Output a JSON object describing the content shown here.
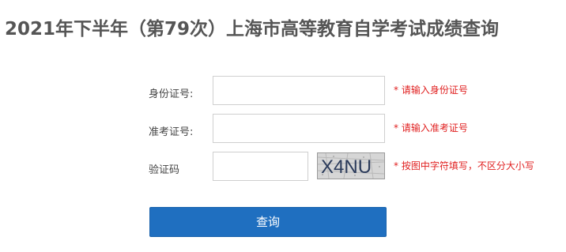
{
  "page": {
    "title": "2021年下半年（第79次）上海市高等教育自学考试成绩查询"
  },
  "form": {
    "id_card": {
      "label": "身份证号:",
      "value": "",
      "hint": "* 请输入身份证号"
    },
    "exam_number": {
      "label": "准考证号:",
      "value": "",
      "hint": "* 请输入准考证号"
    },
    "captcha": {
      "label": "验证码",
      "value": "",
      "image_text": "X4NU",
      "hint": "* 按图中字符填写，不区分大小写"
    },
    "submit_label": "查询"
  },
  "colors": {
    "accent": "#1f6fc0",
    "hint_red": "#e02020",
    "title_gray": "#555555"
  }
}
